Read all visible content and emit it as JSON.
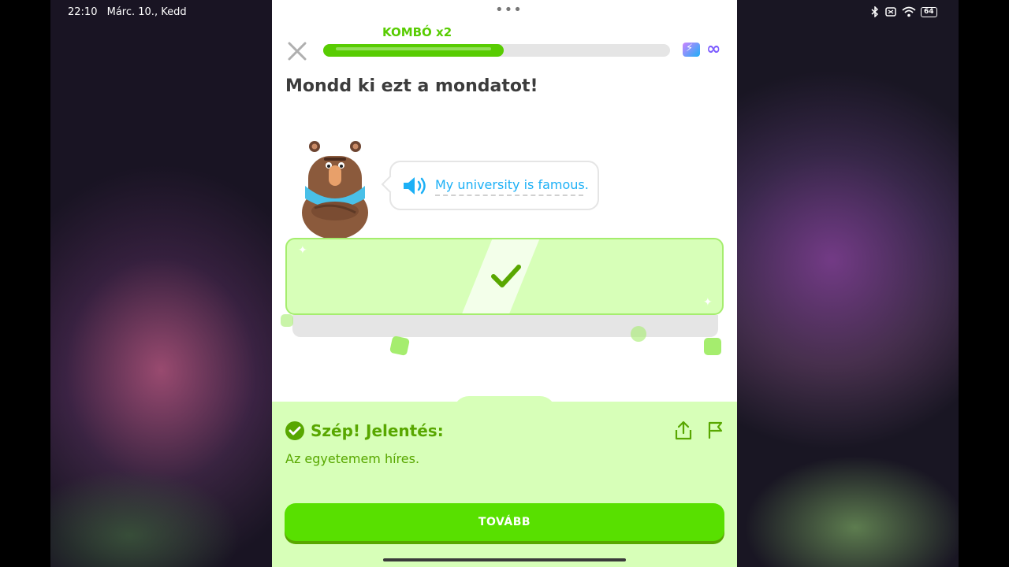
{
  "status_bar": {
    "time": "22:10",
    "date": "Márc. 10., Kedd",
    "battery": "64",
    "icons": [
      "bluetooth-icon",
      "vibrate-icon",
      "wifi-icon",
      "battery-icon"
    ]
  },
  "lesson": {
    "combo_label": "KOMBÓ x2",
    "progress": 0.52,
    "prompt_title": "Mondd ki ezt a mondatot!",
    "sentence": "My university is famous."
  },
  "feedback": {
    "title": "Szép! Jelentés:",
    "translation": "Az egyetemem híres.",
    "continue_label": "TOVÁBB"
  },
  "colors": {
    "brand_green": "#58cc02",
    "feedback_bg": "#d7ffb8",
    "feedback_text": "#58a700",
    "button_green": "#58e000",
    "sentence_blue": "#1cb0f6"
  }
}
